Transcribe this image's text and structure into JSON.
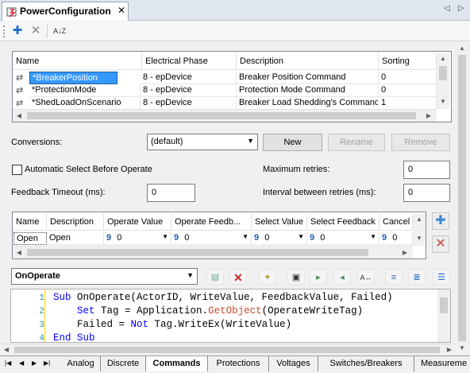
{
  "title": "PowerConfiguration",
  "close_glyph": "✕",
  "nav": {
    "left": "◁",
    "right": "▷"
  },
  "toolbar": {
    "add_glyph": "✚",
    "delete_glyph": "✕",
    "sort_glyph": "A↓Z"
  },
  "points_table": {
    "columns": [
      "Name",
      "Electrical Phase",
      "Description",
      "Sorting"
    ],
    "rows": [
      {
        "name": "*BreakerPosition",
        "phase": "8 - epDevice",
        "description": "Breaker Position Command",
        "sorting": "0"
      },
      {
        "name": "*ProtectionMode",
        "phase": "8 - epDevice",
        "description": "Protection Mode Command",
        "sorting": "0"
      },
      {
        "name": "*ShedLoadOnScenario",
        "phase": "8 - epDevice",
        "description": "Breaker Load Shedding's Command in",
        "sorting": "1"
      }
    ]
  },
  "conversions": {
    "label": "Conversions:",
    "value": "(default)",
    "new": "New",
    "rename": "Rename",
    "remove": "Remove"
  },
  "auto_select": {
    "label": "Automatic Select Before Operate",
    "checked": false
  },
  "max_retries": {
    "label": "Maximum retries:",
    "value": "0"
  },
  "feedback_timeout": {
    "label": "Feedback Timeout (ms):",
    "value": "0"
  },
  "interval_retries": {
    "label": "Interval between retries (ms):",
    "value": "0"
  },
  "operations_table": {
    "columns": [
      "Name",
      "Description",
      "Operate Value",
      "Operate Feedb...",
      "Select Value",
      "Select Feedback",
      "Cancel V"
    ],
    "rows": [
      {
        "name": "Open",
        "description": "Open",
        "operate_value": "0",
        "operate_feedback": "0",
        "select_value": "0",
        "select_feedback": "0",
        "cancel_value": "0"
      }
    ],
    "type_glyph": "9"
  },
  "side_buttons": {
    "add": "✚",
    "delete": "✕"
  },
  "event": {
    "value": "OnOperate"
  },
  "code": {
    "line_numbers": [
      "1",
      "2",
      "3",
      "4"
    ],
    "lines": [
      "Sub OnOperate(ActorID, WriteValue, FeedbackValue, Failed)",
      "    Set Tag = Application.GetObject(OperateWriteTag)",
      "    Failed = Not Tag.WriteEx(WriteValue)",
      "End Sub"
    ]
  },
  "bottom_tabs": [
    "Analog",
    "Discrete",
    "Commands",
    "Protections",
    "Voltages",
    "Switches/Breakers",
    "Measureme"
  ],
  "active_tab": "Commands"
}
